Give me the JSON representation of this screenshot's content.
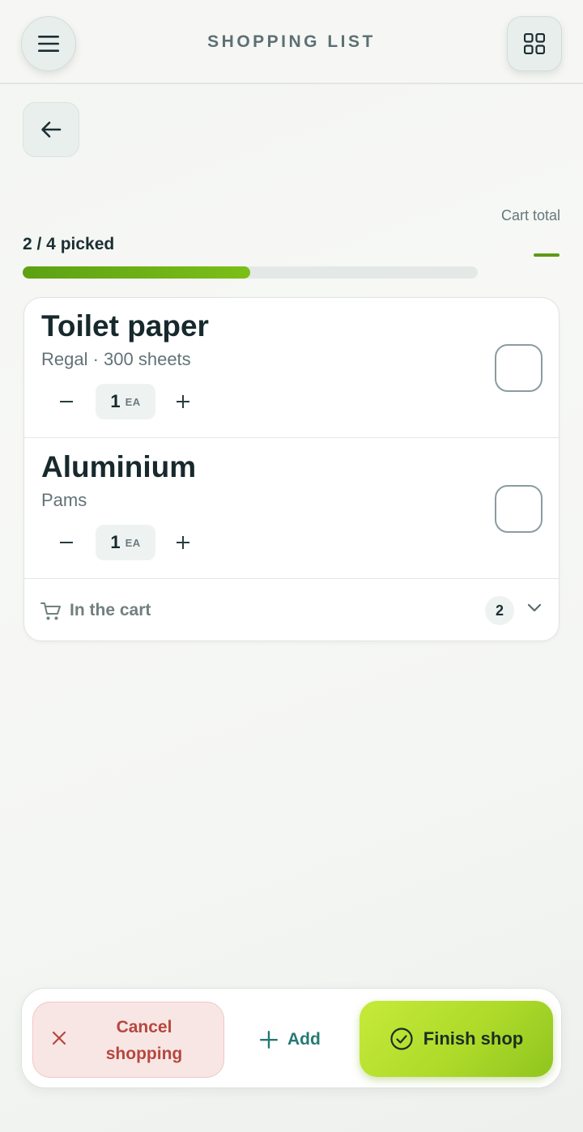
{
  "header": {
    "title": "SHOPPING LIST",
    "menu_icon": "menu-icon",
    "grid_icon": "grid-icon"
  },
  "navigation": {
    "back_icon": "arrow-left-icon"
  },
  "summary": {
    "cart_total_label": "Cart total",
    "cart_total_value": "—",
    "picked_label": "2 / 4 picked",
    "picked_fraction": 0.5
  },
  "items": [
    {
      "name": "Toilet paper",
      "subtitle": "Regal · 300 sheets",
      "quantity": "1",
      "unit": "EA",
      "checked": false
    },
    {
      "name": "Aluminium",
      "subtitle": "Pams",
      "quantity": "1",
      "unit": "EA",
      "checked": false
    }
  ],
  "cart_section": {
    "label": "In the cart",
    "count": "2",
    "icon": "cart-icon",
    "toggle_icon": "chevron-down-icon"
  },
  "bottom_bar": {
    "cancel_label": "Cancel shopping",
    "add_label": "Add",
    "finish_label": "Finish shop"
  },
  "colors": {
    "accent_green": "#7cbf18",
    "finish_button": "#b5e030",
    "cancel_text": "#b5473f",
    "add_text": "#257a74"
  }
}
